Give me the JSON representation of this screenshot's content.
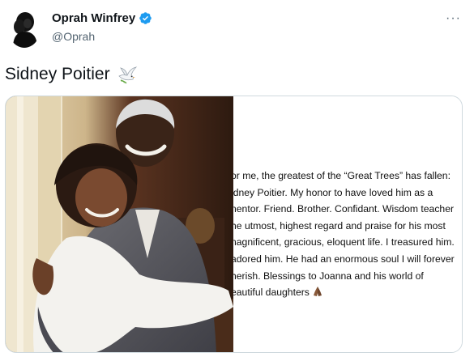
{
  "user": {
    "display_name": "Oprah Winfrey",
    "handle": "@Oprah",
    "avatar_icon": "avatar-silhouette-icon",
    "verified_color": "#1d9bf0"
  },
  "menu": {
    "more_label": "···"
  },
  "tweet": {
    "text": "Sidney Poitier",
    "emoji_icon": "dove-icon"
  },
  "media": {
    "photo_alt": "photo-of-two-people-hugging",
    "note_lines": [
      "or me, the greatest of the “Great Trees” has fallen:",
      "idney Poitier. My honor to have loved him as a",
      "nentor. Friend. Brother. Confidant. Wisdom teacher",
      "he utmost, highest regard and praise for his most",
      "nagnificent, gracious, eloquent life. I treasured him.",
      "adored him. He had an enormous soul I will forever",
      "herish. Blessings to Joanna and his world of",
      "eautiful daughters"
    ],
    "note_end_icon": "folded-hands-icon"
  },
  "colors": {
    "text_primary": "#0f1419",
    "text_secondary": "#536471",
    "border": "#cfd9de"
  }
}
